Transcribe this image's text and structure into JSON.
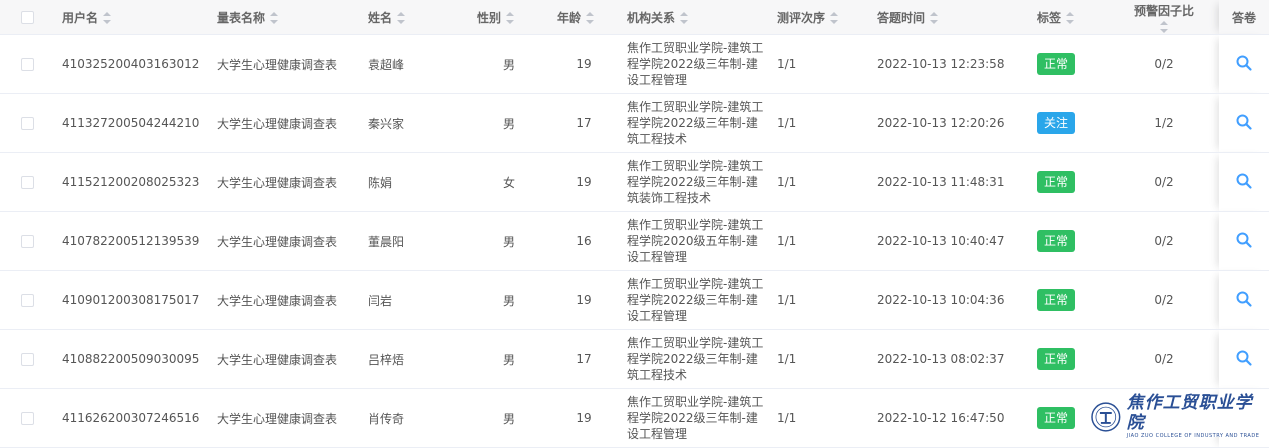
{
  "columns": {
    "user_id": "用户名",
    "scale_name": "量表名称",
    "name": "姓名",
    "gender": "性别",
    "age": "年龄",
    "org": "机构关系",
    "order": "测评次序",
    "time": "答题时间",
    "tag": "标签",
    "ratio": "预警因子比",
    "answer": "答卷"
  },
  "rows": [
    {
      "user_id": "410325200403163012",
      "scale_name": "大学生心理健康调查表",
      "name": "袁超峰",
      "gender": "男",
      "age": "19",
      "org": "焦作工贸职业学院-建筑工程学院2022级三年制-建设工程管理",
      "order": "1/1",
      "time": "2022-10-13 12:23:58",
      "tag": "正常",
      "tag_type": "ok",
      "ratio": "0/2"
    },
    {
      "user_id": "411327200504244210",
      "scale_name": "大学生心理健康调查表",
      "name": "秦兴家",
      "gender": "男",
      "age": "17",
      "org": "焦作工贸职业学院-建筑工程学院2022级三年制-建筑工程技术",
      "order": "1/1",
      "time": "2022-10-13 12:20:26",
      "tag": "关注",
      "tag_type": "focus",
      "ratio": "1/2"
    },
    {
      "user_id": "411521200208025323",
      "scale_name": "大学生心理健康调查表",
      "name": "陈娟",
      "gender": "女",
      "age": "19",
      "org": "焦作工贸职业学院-建筑工程学院2022级三年制-建筑装饰工程技术",
      "order": "1/1",
      "time": "2022-10-13 11:48:31",
      "tag": "正常",
      "tag_type": "ok",
      "ratio": "0/2"
    },
    {
      "user_id": "410782200512139539",
      "scale_name": "大学生心理健康调查表",
      "name": "董晨阳",
      "gender": "男",
      "age": "16",
      "org": "焦作工贸职业学院-建筑工程学院2020级五年制-建设工程管理",
      "order": "1/1",
      "time": "2022-10-13 10:40:47",
      "tag": "正常",
      "tag_type": "ok",
      "ratio": "0/2"
    },
    {
      "user_id": "410901200308175017",
      "scale_name": "大学生心理健康调查表",
      "name": "闫岩",
      "gender": "男",
      "age": "19",
      "org": "焦作工贸职业学院-建筑工程学院2022级三年制-建设工程管理",
      "order": "1/1",
      "time": "2022-10-13 10:04:36",
      "tag": "正常",
      "tag_type": "ok",
      "ratio": "0/2"
    },
    {
      "user_id": "410882200509030095",
      "scale_name": "大学生心理健康调查表",
      "name": "吕梓焐",
      "gender": "男",
      "age": "17",
      "org": "焦作工贸职业学院-建筑工程学院2022级三年制-建筑工程技术",
      "order": "1/1",
      "time": "2022-10-13 08:02:37",
      "tag": "正常",
      "tag_type": "ok",
      "ratio": "0/2"
    },
    {
      "user_id": "411626200307246516",
      "scale_name": "大学生心理健康调查表",
      "name": "肖传奇",
      "gender": "男",
      "age": "19",
      "org": "焦作工贸职业学院-建筑工程学院2022级三年制-建设工程管理",
      "order": "1/1",
      "time": "2022-10-12 16:47:50",
      "tag": "正常",
      "tag_type": "ok",
      "ratio": ""
    }
  ],
  "logo": {
    "cn": "焦作工贸职业学院",
    "en": "JIAO ZUO COLLEGE OF INDUSTRY AND TRADE"
  },
  "icons": {
    "answer": "search-icon",
    "logo": "college-emblem-icon"
  },
  "colors": {
    "tag_normal": "#2fbf63",
    "tag_focus": "#2aa6ea",
    "search_icon": "#409eff",
    "logo": "#2a4f95"
  }
}
